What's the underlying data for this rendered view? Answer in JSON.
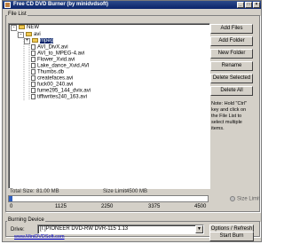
{
  "window": {
    "title": "Free CD DVD Burner (by minidvdsoft)"
  },
  "file_list": {
    "label": "File List",
    "tree": [
      {
        "label": "NEW",
        "type": "folder",
        "expander": "-"
      },
      {
        "label": "avi",
        "type": "folder",
        "expander": "-"
      },
      {
        "label": "mpeg",
        "type": "folder",
        "expander": "+",
        "selected": true
      },
      {
        "label": "AVI_DivX.avi",
        "type": "file"
      },
      {
        "label": "AVI_to_MPEG-4.avi",
        "type": "file"
      },
      {
        "label": "Flower_Xvid.avi",
        "type": "file"
      },
      {
        "label": "Lake_dance_Xvid.AVI",
        "type": "file"
      },
      {
        "label": "Thumbs.db",
        "type": "file"
      },
      {
        "label": "createfaces.avi",
        "type": "file"
      },
      {
        "label": "fuck00_240.avi",
        "type": "file"
      },
      {
        "label": "fume295_144_dvix.avi",
        "type": "file"
      },
      {
        "label": "tiffiwrites240_163.avi",
        "type": "file"
      }
    ]
  },
  "buttons": {
    "add_files": "Add Files",
    "add_folder": "Add Folder",
    "new_folder": "New Folder",
    "rename": "Rename",
    "delete_selected": "Delete Selected",
    "delete_all": "Delete All"
  },
  "note": "Note: Hold \"Ctrl\" key and click on the File List to select multiple items.",
  "stats": {
    "total_size_label": "Total Size:",
    "total_size_value": "81.00 MB",
    "size_limit_label": "Size Limit:",
    "size_limit_value": "4500 MB"
  },
  "capacity": {
    "fill_fraction": 0.018,
    "ticks": [
      "0",
      "1125",
      "2250",
      "3375",
      "4500"
    ],
    "size_limit_text": "Size Limit"
  },
  "burning_device": {
    "label": "Burning Device",
    "drive_label": "Drive:",
    "drive_value": "[I:]PIONEER DVD-RW  DVR-115 1.13",
    "options_button": "Options / Refresh"
  },
  "footer": {
    "link": "www.MiniDVDSoft.com",
    "start_burn": "Start Burn"
  },
  "colors": {
    "window_bg": "#d4d0c8",
    "titlebar": "#0a246a",
    "selection": "#0a246a",
    "folder": "#f0c850",
    "link": "#0000cc"
  }
}
